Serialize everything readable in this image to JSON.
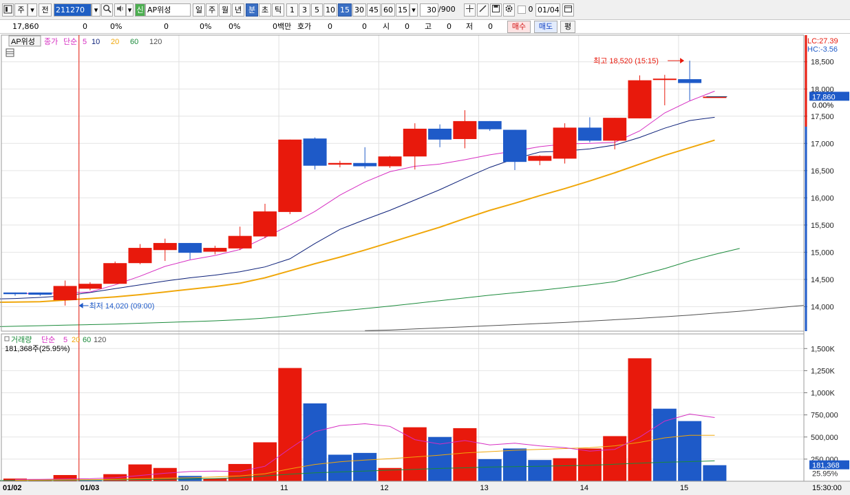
{
  "toolbar": {
    "period_unit": "주",
    "prev_label": "전",
    "stock_code": "211270",
    "market_badge": "신",
    "stock_name": "AP위성",
    "periods": [
      "일",
      "주",
      "월",
      "년",
      "분",
      "초",
      "틱"
    ],
    "selected_period": "분",
    "intervals": [
      "1",
      "3",
      "5",
      "10",
      "15",
      "30",
      "45",
      "60"
    ],
    "selected_interval": "15",
    "interval_select": "15",
    "count": "30",
    "count_total": "/900",
    "check_value": "0",
    "date": "01/04"
  },
  "infobar": {
    "price": "17,860",
    "change": "0",
    "change_pct": "0%",
    "volume": "0",
    "vol_pct": "0%",
    "other_pct": "0%",
    "amount": "0백만",
    "hoga_label": "호가",
    "hoga1": "0",
    "hoga2": "0",
    "open_label": "시",
    "open": "0",
    "high_label": "고",
    "high": "0",
    "low_label": "저",
    "low": "0",
    "buy": "매수",
    "sell": "매도",
    "avg": "평"
  },
  "colors": {
    "up": "#e8190c",
    "down": "#1e5ac8",
    "ma5": "#d62dc2",
    "ma10": "#0a1e78",
    "ma20": "#f0a70a",
    "ma60": "#1a8a3a",
    "ma120": "#505050"
  },
  "chart_data": [
    {
      "type": "candlestick",
      "legend": {
        "stock": "AP위성",
        "items": [
          "종가",
          "단순",
          "5",
          "10",
          "20",
          "60",
          "120"
        ]
      },
      "y_ticks": [
        "18,500",
        "18,000",
        "17,500",
        "17,000",
        "16,500",
        "16,000",
        "15,500",
        "15,000",
        "14,500",
        "14,000"
      ],
      "ylim": [
        13550,
        18990
      ],
      "right_labels": {
        "lc": "LC:27.39",
        "hc": "HC:-3.56",
        "current": "17,860",
        "current_pct": "0.00%"
      },
      "annotations": {
        "high": "최고 18,520 (15:15)",
        "low": "최저 14,020 (09:00)"
      },
      "candles": [
        {
          "o": 14260,
          "h": 14260,
          "l": 14200,
          "c": 14230
        },
        {
          "o": 14260,
          "h": 14260,
          "l": 14200,
          "c": 14220
        },
        {
          "o": 14120,
          "h": 14480,
          "l": 14020,
          "c": 14380
        },
        {
          "o": 14330,
          "h": 14450,
          "l": 14300,
          "c": 14420
        },
        {
          "o": 14420,
          "h": 14830,
          "l": 14420,
          "c": 14800
        },
        {
          "o": 14800,
          "h": 15150,
          "l": 14780,
          "c": 15080
        },
        {
          "o": 15040,
          "h": 15250,
          "l": 14840,
          "c": 15170
        },
        {
          "o": 15170,
          "h": 15170,
          "l": 14870,
          "c": 14990
        },
        {
          "o": 15010,
          "h": 15120,
          "l": 14960,
          "c": 15080
        },
        {
          "o": 15070,
          "h": 15470,
          "l": 15040,
          "c": 15300
        },
        {
          "o": 15290,
          "h": 15890,
          "l": 15260,
          "c": 15750
        },
        {
          "o": 15740,
          "h": 17070,
          "l": 15700,
          "c": 17070
        },
        {
          "o": 17090,
          "h": 17110,
          "l": 16520,
          "c": 16590
        },
        {
          "o": 16610,
          "h": 16680,
          "l": 16560,
          "c": 16640
        },
        {
          "o": 16640,
          "h": 16930,
          "l": 16540,
          "c": 16580
        },
        {
          "o": 16580,
          "h": 16770,
          "l": 16550,
          "c": 16760
        },
        {
          "o": 16760,
          "h": 17370,
          "l": 16520,
          "c": 17270
        },
        {
          "o": 17270,
          "h": 17350,
          "l": 16930,
          "c": 17070
        },
        {
          "o": 17080,
          "h": 17610,
          "l": 16910,
          "c": 17410
        },
        {
          "o": 17410,
          "h": 17410,
          "l": 17230,
          "c": 17260
        },
        {
          "o": 17250,
          "h": 17250,
          "l": 16510,
          "c": 16660
        },
        {
          "o": 16680,
          "h": 16780,
          "l": 16600,
          "c": 16770
        },
        {
          "o": 16720,
          "h": 17370,
          "l": 16630,
          "c": 17290
        },
        {
          "o": 17290,
          "h": 17480,
          "l": 17020,
          "c": 17050
        },
        {
          "o": 17050,
          "h": 17470,
          "l": 16890,
          "c": 17470
        },
        {
          "o": 17460,
          "h": 18250,
          "l": 17460,
          "c": 18160
        },
        {
          "o": 18170,
          "h": 18260,
          "l": 17700,
          "c": 18190
        },
        {
          "o": 18180,
          "h": 18520,
          "l": 17790,
          "c": 18110
        },
        {
          "o": 17860,
          "h": 17860,
          "l": 17860,
          "c": 17860
        }
      ],
      "ma5": [
        14240,
        14245,
        14255,
        14270,
        14400,
        14560,
        14740,
        14860,
        14940,
        15050,
        15270,
        15500,
        15750,
        16050,
        16290,
        16480,
        16580,
        16620,
        16700,
        16790,
        16860,
        16940,
        16990,
        17000,
        17020,
        17230,
        17560,
        17780,
        17960
      ],
      "ma10": [
        14140,
        14150,
        14170,
        14200,
        14260,
        14330,
        14400,
        14470,
        14530,
        14580,
        14640,
        14730,
        14880,
        15160,
        15420,
        15600,
        15770,
        15960,
        16150,
        16360,
        16560,
        16720,
        16840,
        16860,
        16900,
        16970,
        17110,
        17280,
        17420,
        17480
      ],
      "ma20": [
        14080,
        14085,
        14090,
        14120,
        14150,
        14180,
        14220,
        14270,
        14320,
        14370,
        14430,
        14530,
        14660,
        14790,
        14910,
        15040,
        15180,
        15320,
        15460,
        15620,
        15770,
        15900,
        16040,
        16170,
        16310,
        16460,
        16620,
        16780,
        16920,
        17060
      ],
      "ma60": [
        13630,
        13640,
        13650,
        13660,
        13670,
        13680,
        13695,
        13710,
        13725,
        13740,
        13760,
        13790,
        13830,
        13875,
        13920,
        13965,
        14010,
        14060,
        14110,
        14160,
        14210,
        14255,
        14300,
        14350,
        14400,
        14460,
        14580,
        14700,
        14840,
        14960,
        15070
      ],
      "ma120": [
        13560,
        13570,
        13590,
        13610,
        13630,
        13650,
        13670,
        13690,
        13710,
        13735,
        13760,
        13785,
        13815,
        13845,
        13880,
        13915,
        13960,
        14000,
        14040,
        14100
      ]
    },
    {
      "type": "bar",
      "legend": {
        "items": [
          "거래량",
          "단순",
          "5",
          "20",
          "60",
          "120"
        ],
        "current": "181,368주(25.95%)"
      },
      "y_ticks": [
        "1,500K",
        "1,250K",
        "1,000K",
        "750,000",
        "500,000",
        "250,000"
      ],
      "ylim": [
        0,
        1650000
      ],
      "right_labels": {
        "current": "181,368",
        "current_pct": "25.95%"
      },
      "volume": [
        30000,
        18000,
        70000,
        10000,
        80000,
        190000,
        150000,
        60000,
        30000,
        195000,
        440000,
        1280000,
        880000,
        300000,
        320000,
        150000,
        610000,
        500000,
        600000,
        250000,
        370000,
        240000,
        260000,
        370000,
        510000,
        1390000,
        820000,
        680000,
        181368
      ],
      "up": [
        true,
        true,
        true,
        false,
        true,
        true,
        true,
        false,
        true,
        true,
        true,
        true,
        false,
        false,
        false,
        true,
        true,
        false,
        true,
        false,
        false,
        false,
        true,
        true,
        true,
        true,
        false,
        false,
        false
      ],
      "ma5": [
        20000,
        22000,
        25000,
        28000,
        40000,
        65000,
        90000,
        110000,
        115000,
        110000,
        170000,
        370000,
        560000,
        630000,
        650000,
        620000,
        470000,
        420000,
        460000,
        410000,
        430000,
        400000,
        380000,
        340000,
        360000,
        500000,
        680000,
        760000,
        720000
      ],
      "ma20": [
        12000,
        14000,
        16000,
        18000,
        22000,
        28000,
        34000,
        40000,
        48000,
        60000,
        85000,
        140000,
        190000,
        220000,
        240000,
        255000,
        275000,
        295000,
        320000,
        335000,
        350000,
        360000,
        370000,
        380000,
        400000,
        440000,
        490000,
        520000,
        520000
      ],
      "ma60": [
        8000,
        9000,
        10000,
        12000,
        14000,
        16000,
        19000,
        22000,
        25000,
        30000,
        40000,
        60000,
        80000,
        95000,
        105000,
        115000,
        125000,
        135000,
        145000,
        152000,
        160000,
        165000,
        170000,
        175000,
        180000,
        192000,
        205000,
        215000,
        222000,
        230000
      ]
    }
  ],
  "x_axis": {
    "labels": [
      {
        "text": "01/02",
        "slot": 0
      },
      {
        "text": "01/03",
        "slot": 3
      },
      {
        "text": "10",
        "slot": 7
      },
      {
        "text": "11",
        "slot": 11
      },
      {
        "text": "12",
        "slot": 15
      },
      {
        "text": "13",
        "slot": 19
      },
      {
        "text": "14",
        "slot": 23
      },
      {
        "text": "15",
        "slot": 27
      }
    ],
    "right_time": "15:30:00"
  }
}
